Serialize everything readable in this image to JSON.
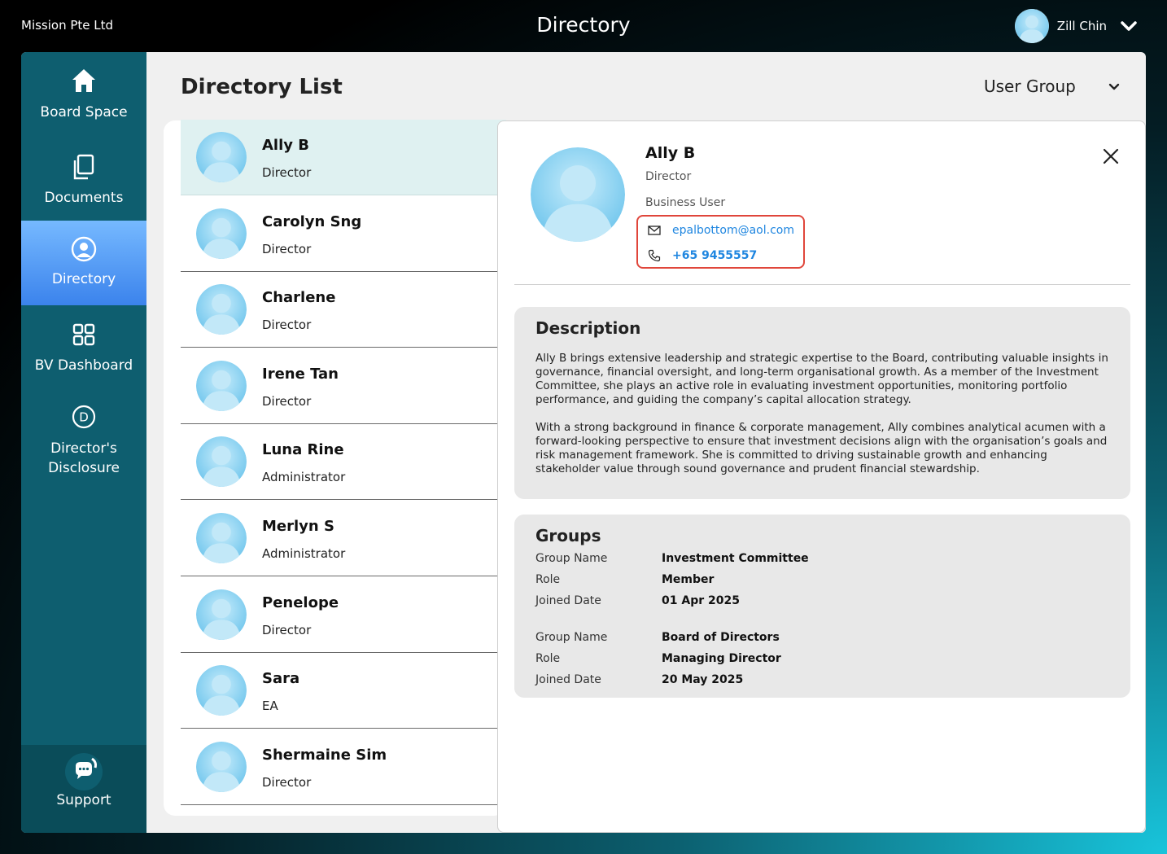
{
  "header": {
    "company": "Mission Pte Ltd",
    "title": "Directory",
    "user_name": "Zill Chin"
  },
  "sidebar": {
    "items": [
      {
        "label": "Board Space",
        "icon": "home-icon"
      },
      {
        "label": "Documents",
        "icon": "documents-icon"
      },
      {
        "label": "Directory",
        "icon": "user-circle-icon",
        "active": true
      },
      {
        "label": "BV Dashboard",
        "icon": "grid-icon"
      },
      {
        "label": "Director's Disclosure",
        "icon": "d-circle-icon"
      }
    ],
    "support_label": "Support"
  },
  "main": {
    "title": "Directory List",
    "group_filter": "User Group"
  },
  "directory": [
    {
      "name": "Ally B",
      "role": "Director",
      "selected": true
    },
    {
      "name": "Carolyn Sng",
      "role": "Director"
    },
    {
      "name": "Charlene",
      "role": "Director"
    },
    {
      "name": "Irene Tan",
      "role": "Director"
    },
    {
      "name": "Luna Rine",
      "role": "Administrator"
    },
    {
      "name": "Merlyn S",
      "role": "Administrator"
    },
    {
      "name": "Penelope",
      "role": "Director"
    },
    {
      "name": "Sara",
      "role": "EA"
    },
    {
      "name": "Shermaine Sim",
      "role": "Director"
    }
  ],
  "detail": {
    "name": "Ally B",
    "role": "Director",
    "user_type": "Business User",
    "email": "epalbottom@aol.com",
    "phone": "+65 9455557",
    "description_title": "Description",
    "description": [
      "Ally B brings extensive leadership and strategic expertise to the Board, contributing valuable insights in governance, financial oversight, and long-term organisational growth. As a member of the Investment Committee, she plays an active role in evaluating investment opportunities, monitoring portfolio performance, and guiding the company’s capital allocation strategy.",
      "With a strong background in finance & corporate management, Ally combines analytical acumen with a forward-looking perspective to ensure that investment decisions align with the organisation’s goals and risk management framework. She is committed to driving sustainable growth and enhancing stakeholder value through sound governance and prudent financial stewardship."
    ],
    "groups_title": "Groups",
    "group_labels": {
      "name": "Group Name",
      "role": "Role",
      "joined": "Joined Date"
    },
    "groups": [
      {
        "name": "Investment Committee",
        "role": "Member",
        "joined": "01 Apr 2025"
      },
      {
        "name": "Board of Directors",
        "role": "Managing Director",
        "joined": "20 May 2025"
      }
    ]
  },
  "colors": {
    "sidebar": "#0e5e6f",
    "active": "#3b83ec",
    "link": "#1f86e0",
    "highlight": "#e0463b",
    "selected_row": "#dff1f1"
  }
}
